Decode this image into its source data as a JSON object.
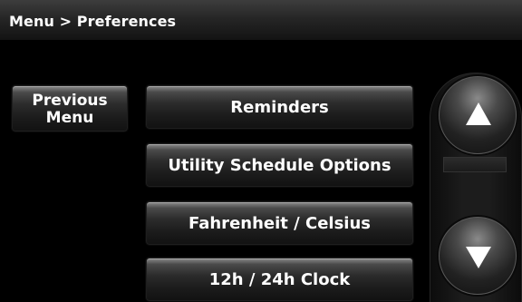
{
  "header": {
    "breadcrumb": "Menu > Preferences"
  },
  "nav": {
    "previous_menu_line1": "Previous",
    "previous_menu_line2": "Menu"
  },
  "menu": {
    "items": [
      {
        "label": "Reminders"
      },
      {
        "label": "Utility Schedule Options"
      },
      {
        "label": "Fahrenheit / Celsius"
      },
      {
        "label": "12h / 24h Clock"
      }
    ]
  },
  "scroll": {
    "up_icon": "arrow-up-icon",
    "down_icon": "arrow-down-icon"
  },
  "colors": {
    "background": "#000000",
    "button_top": "#8c8c8c",
    "button_bottom": "#121212",
    "text": "#ffffff"
  }
}
